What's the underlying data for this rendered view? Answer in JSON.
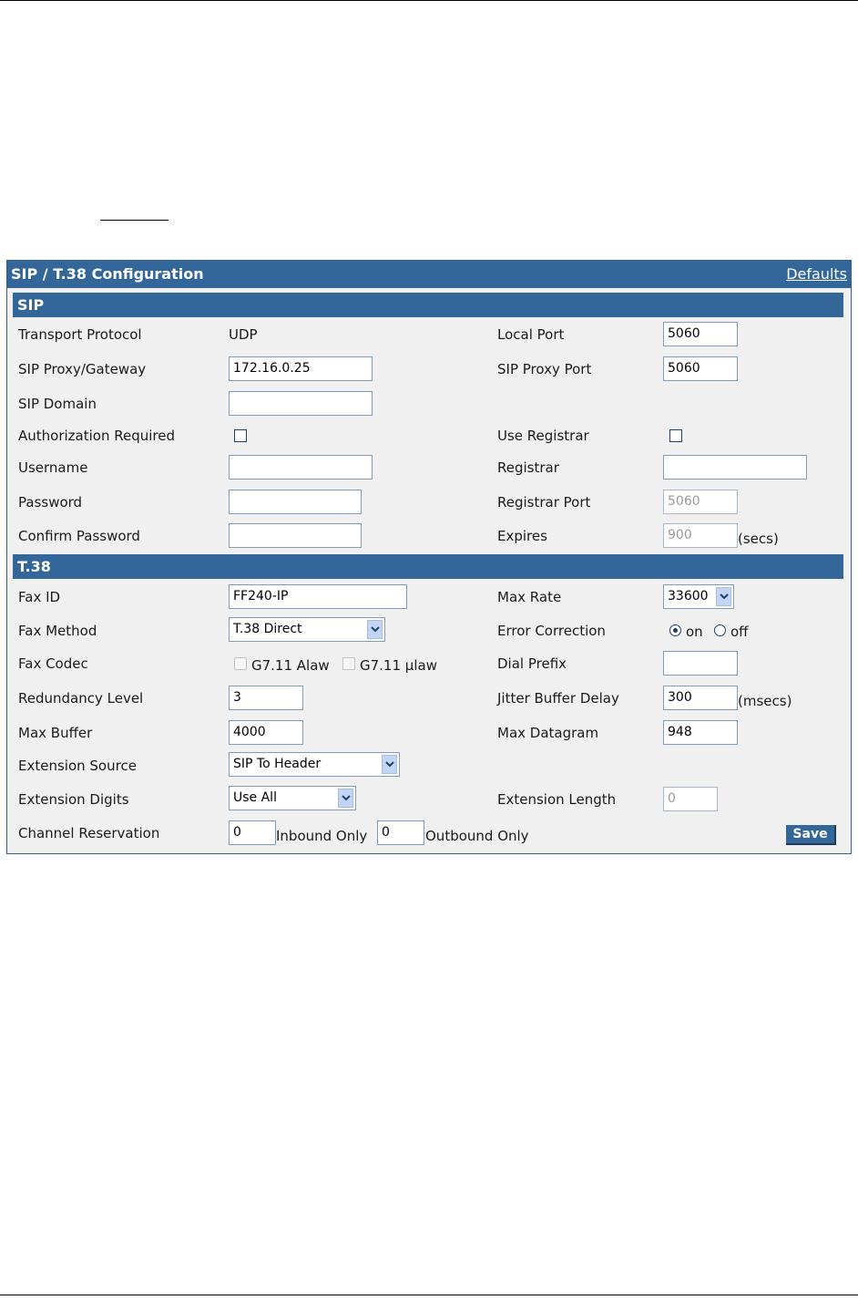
{
  "panel": {
    "title": "SIP / T.38 Configuration",
    "defaults_link": "Defaults"
  },
  "sip": {
    "section_title": "SIP",
    "transport_protocol": {
      "label": "Transport Protocol",
      "value": "UDP"
    },
    "local_port": {
      "label": "Local Port",
      "value": "5060"
    },
    "proxy_gateway": {
      "label": "SIP Proxy/Gateway",
      "value": "172.16.0.25"
    },
    "proxy_port": {
      "label": "SIP Proxy Port",
      "value": "5060"
    },
    "domain": {
      "label": "SIP Domain",
      "value": ""
    },
    "auth_required": {
      "label": "Authorization Required",
      "checked": false
    },
    "use_registrar": {
      "label": "Use Registrar",
      "checked": false
    },
    "username": {
      "label": "Username",
      "value": ""
    },
    "registrar": {
      "label": "Registrar",
      "value": ""
    },
    "password": {
      "label": "Password",
      "value": ""
    },
    "registrar_port": {
      "label": "Registrar Port",
      "value": "5060"
    },
    "confirm_password": {
      "label": "Confirm Password",
      "value": ""
    },
    "expires": {
      "label": "Expires",
      "value": "900",
      "unit": "(secs)"
    }
  },
  "t38": {
    "section_title": "T.38",
    "fax_id": {
      "label": "Fax ID",
      "value": "FF240-IP"
    },
    "max_rate": {
      "label": "Max Rate",
      "selected": "33600"
    },
    "fax_method": {
      "label": "Fax Method",
      "selected": "T.38 Direct"
    },
    "error_correction": {
      "label": "Error Correction",
      "on_label": "on",
      "off_label": "off",
      "selected": "on"
    },
    "fax_codec": {
      "label": "Fax Codec",
      "alaw_label": "G7.11 Alaw",
      "ulaw_label": "G7.11 µlaw"
    },
    "dial_prefix": {
      "label": "Dial Prefix",
      "value": ""
    },
    "redundancy_level": {
      "label": "Redundancy Level",
      "value": "3"
    },
    "jitter_buffer_delay": {
      "label": "Jitter Buffer Delay",
      "value": "300",
      "unit": "(msecs)"
    },
    "max_buffer": {
      "label": "Max Buffer",
      "value": "4000"
    },
    "max_datagram": {
      "label": "Max Datagram",
      "value": "948"
    },
    "extension_source": {
      "label": "Extension Source",
      "selected": "SIP To Header"
    },
    "extension_digits": {
      "label": "Extension Digits",
      "selected": "Use All"
    },
    "extension_length": {
      "label": "Extension Length",
      "value": "0"
    },
    "channel_reservation": {
      "label": "Channel Reservation",
      "inbound_value": "0",
      "inbound_label": "Inbound Only",
      "outbound_value": "0",
      "outbound_label": "Outbound Only"
    },
    "save_label": "Save"
  },
  "colors": {
    "header": "#336699",
    "panel_bg": "#f0f0f0",
    "input_border": "#7f9db9"
  }
}
